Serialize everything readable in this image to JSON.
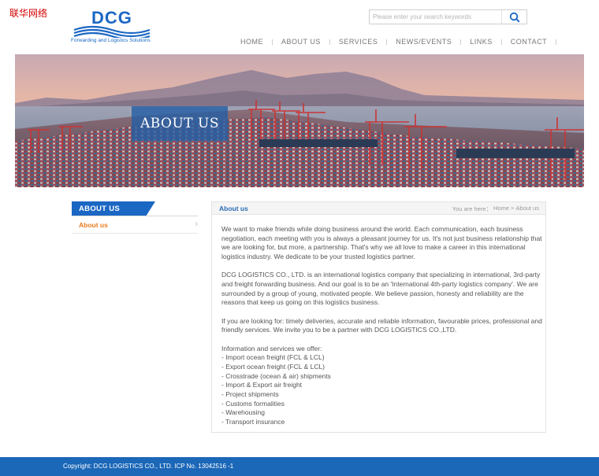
{
  "corner_tag": "联华网络",
  "brand": {
    "name": "DCG",
    "tagline": "Forwarding and Logistics Solutions",
    "accent_color": "#1b67c4"
  },
  "search": {
    "placeholder": "Please enter your search keywords",
    "icon": "search-icon"
  },
  "nav": {
    "items": [
      {
        "label": "HOME"
      },
      {
        "label": "ABOUT US"
      },
      {
        "label": "SERVICES"
      },
      {
        "label": "NEWS/EVENTS"
      },
      {
        "label": "LINKS"
      },
      {
        "label": "CONTACT"
      }
    ]
  },
  "banner": {
    "title": "ABOUT US",
    "image": "port-container-cranes-photo"
  },
  "sidebar": {
    "heading": "ABOUT US",
    "items": [
      {
        "label": "About us",
        "active": true
      }
    ],
    "heading_color": "#1b67c4",
    "active_color": "#e87a1e"
  },
  "content": {
    "title": "About us",
    "breadcrumb": {
      "prefix": "You are here：",
      "home": "Home",
      "separator": ">",
      "current": "About us"
    },
    "paragraphs": [
      "We want to make friends while doing business around the world. Each communication, each business negotiation, each meeting with you is always a pleasant journey for us. It's not just business relationship that we are looking for, but more, a partnership. That's why we all love to make a career in this international logistics industry. We dedicate to be your trusted logistics partner.",
      "DCG LOGISTICS CO., LTD. is an international logistics company that specializing in international, 3rd-party and freight forwarding business. And our goal is to be an 'International 4th-party logistics company'. We are surrounded by a group of young, motivated people. We believe passion, honesty and reliability are the reasons that keep us going on this logistics business.",
      "If you are looking for: timely deliveries, accurate and reliable information, favourable prices, professional and friendly services. We invite you to be a partner with DCG LOGISTICS CO.,LTD."
    ],
    "services_intro": "Information and services we offer:",
    "services": [
      "- Import ocean freight (FCL & LCL)",
      "- Export ocean freight (FCL & LCL)",
      "- Crosstrade (ocean & air) shipments",
      "- Import & Export air freight",
      "- Project shipments",
      "- Customs formalities",
      "- Warehousing",
      "- Transport insurance"
    ]
  },
  "footer": {
    "text": "Copyright: DCG LOGISTICS CO., LTD. ICP No. 13042516 -1",
    "bg_color": "#1b67b8"
  }
}
